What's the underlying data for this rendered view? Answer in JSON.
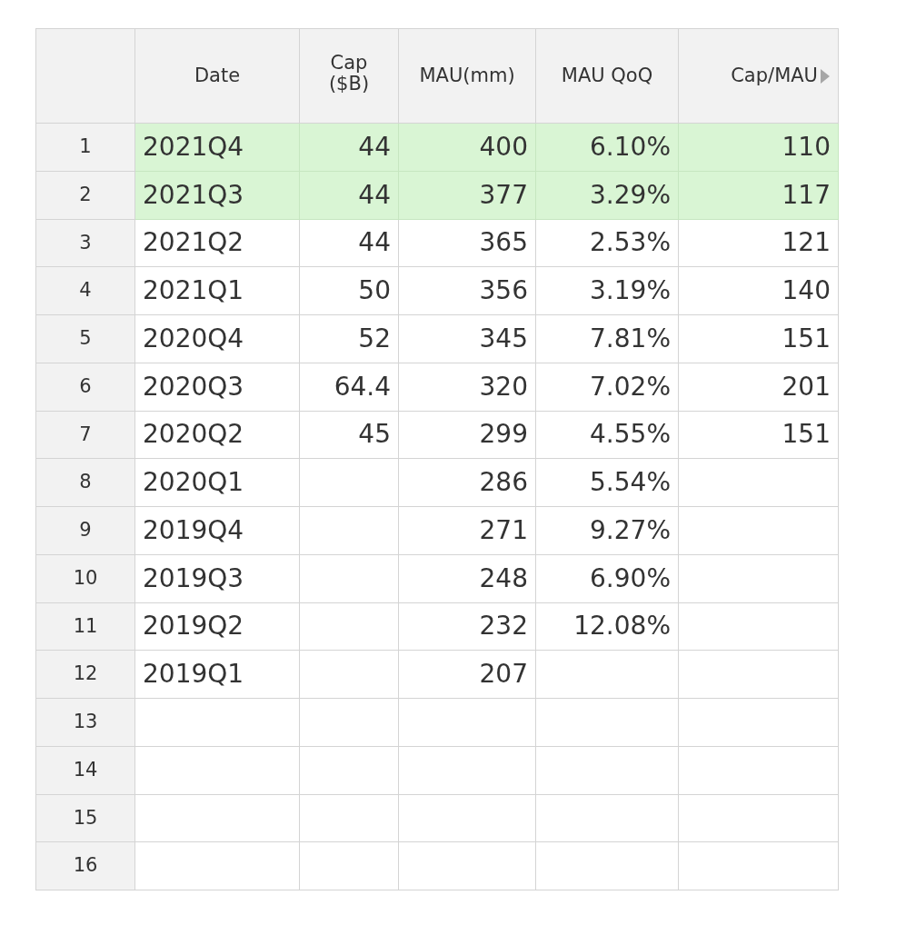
{
  "table": {
    "columns": [
      {
        "label": "Date"
      },
      {
        "label": "Cap ($B)"
      },
      {
        "label": "MAU(mm)"
      },
      {
        "label": "MAU QoQ"
      },
      {
        "label": "Cap/MAU",
        "more_indicator": true
      }
    ],
    "rows": [
      {
        "number": "1",
        "selected": true,
        "date": "2021Q4",
        "cap": "44",
        "mau": "400",
        "mau_qoq": "6.10%",
        "cap_per_mau": "110"
      },
      {
        "number": "2",
        "selected": true,
        "date": "2021Q3",
        "cap": "44",
        "mau": "377",
        "mau_qoq": "3.29%",
        "cap_per_mau": "117"
      },
      {
        "number": "3",
        "selected": false,
        "date": "2021Q2",
        "cap": "44",
        "mau": "365",
        "mau_qoq": "2.53%",
        "cap_per_mau": "121"
      },
      {
        "number": "4",
        "selected": false,
        "date": "2021Q1",
        "cap": "50",
        "mau": "356",
        "mau_qoq": "3.19%",
        "cap_per_mau": "140"
      },
      {
        "number": "5",
        "selected": false,
        "date": "2020Q4",
        "cap": "52",
        "mau": "345",
        "mau_qoq": "7.81%",
        "cap_per_mau": "151"
      },
      {
        "number": "6",
        "selected": false,
        "date": "2020Q3",
        "cap": "64.4",
        "mau": "320",
        "mau_qoq": "7.02%",
        "cap_per_mau": "201"
      },
      {
        "number": "7",
        "selected": false,
        "date": "2020Q2",
        "cap": "45",
        "mau": "299",
        "mau_qoq": "4.55%",
        "cap_per_mau": "151"
      },
      {
        "number": "8",
        "selected": false,
        "date": "2020Q1",
        "mau": "286",
        "mau_qoq": "5.54%"
      },
      {
        "number": "9",
        "selected": false,
        "date": "2019Q4",
        "mau": "271",
        "mau_qoq": "9.27%"
      },
      {
        "number": "10",
        "selected": false,
        "date": "2019Q3",
        "mau": "248",
        "mau_qoq": "6.90%"
      },
      {
        "number": "11",
        "selected": false,
        "date": "2019Q2",
        "mau": "232",
        "mau_qoq": "12.08%"
      },
      {
        "number": "12",
        "selected": false,
        "date": "2019Q1",
        "mau": "207"
      },
      {
        "number": "13",
        "selected": false
      },
      {
        "number": "14",
        "selected": false
      },
      {
        "number": "15",
        "selected": false
      },
      {
        "number": "16",
        "selected": false
      }
    ]
  }
}
